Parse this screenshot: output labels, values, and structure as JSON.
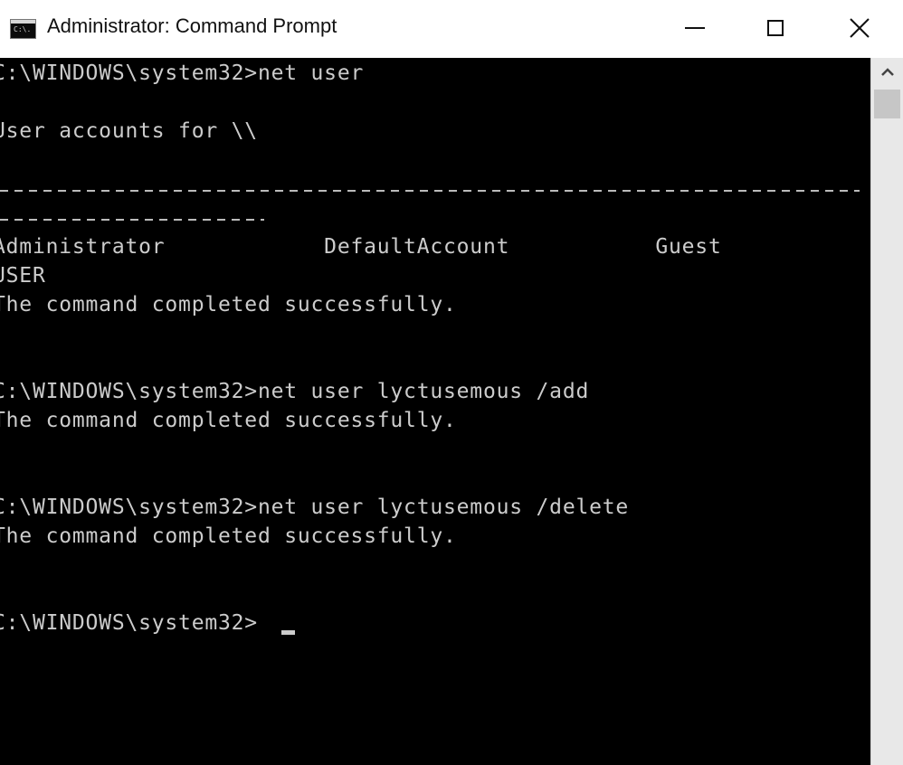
{
  "window": {
    "title": "Administrator: Command Prompt",
    "icon_text": "C:\\.",
    "icon": "cmd-app-icon",
    "controls": [
      "minimize-icon",
      "maximize-icon",
      "close-icon"
    ]
  },
  "console": {
    "lines": [
      "C:\\WINDOWS\\system32>net user",
      "User accounts for \\\\",
      "Administrator            DefaultAccount           Guest",
      "USER",
      "The command completed successfully.",
      "C:\\WINDOWS\\system32>net user lyctusemous /add",
      "The command completed successfully.",
      "C:\\WINDOWS\\system32>net user lyctusemous /delete",
      "The command completed successfully.",
      "C:\\WINDOWS\\system32>"
    ]
  },
  "scrollbar": {
    "up_icon": "chevron-up-icon"
  }
}
